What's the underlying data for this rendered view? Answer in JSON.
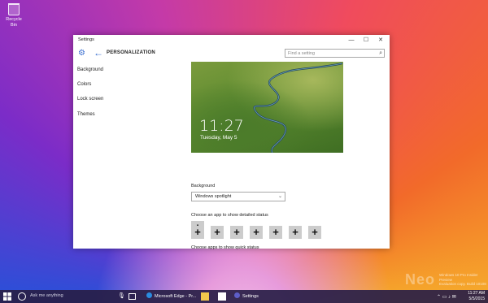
{
  "desktop": {
    "icons": [
      {
        "label": "Recycle Bin",
        "icon": "recycle-bin-icon"
      }
    ],
    "watermark": "Neo",
    "build_line1": "Windows 10 Pro Insider Preview",
    "build_line2": "Evaluation copy. Build 10108"
  },
  "window": {
    "title": "Settings",
    "controls": {
      "minimize": "—",
      "maximize": "☐",
      "close": "✕"
    },
    "header": {
      "page_title": "PERSONALIZATION",
      "search_placeholder": "Find a setting"
    },
    "sidebar": {
      "items": [
        {
          "label": "Background"
        },
        {
          "label": "Colors"
        },
        {
          "label": "Lock screen"
        },
        {
          "label": "Themes"
        }
      ]
    },
    "main": {
      "preview": {
        "time": "11:27",
        "date": "Tuesday, May 5"
      },
      "background_label": "Background",
      "background_value": "Windows spotlight",
      "detailed_status_label": "Choose an app to show detailed status",
      "quick_status_label": "Choose apps to show quick status",
      "plus_glyph": "+",
      "quick_status_slots": 7
    }
  },
  "taskbar": {
    "search_text": "Ask me anything",
    "apps": [
      {
        "label": "Microsoft Edge - Pr...",
        "color": "#2a8ce0"
      },
      {
        "label": "Settings",
        "color": "#5e5ec8"
      }
    ],
    "clock": {
      "time": "11:27 AM",
      "date": "5/5/2015"
    }
  }
}
